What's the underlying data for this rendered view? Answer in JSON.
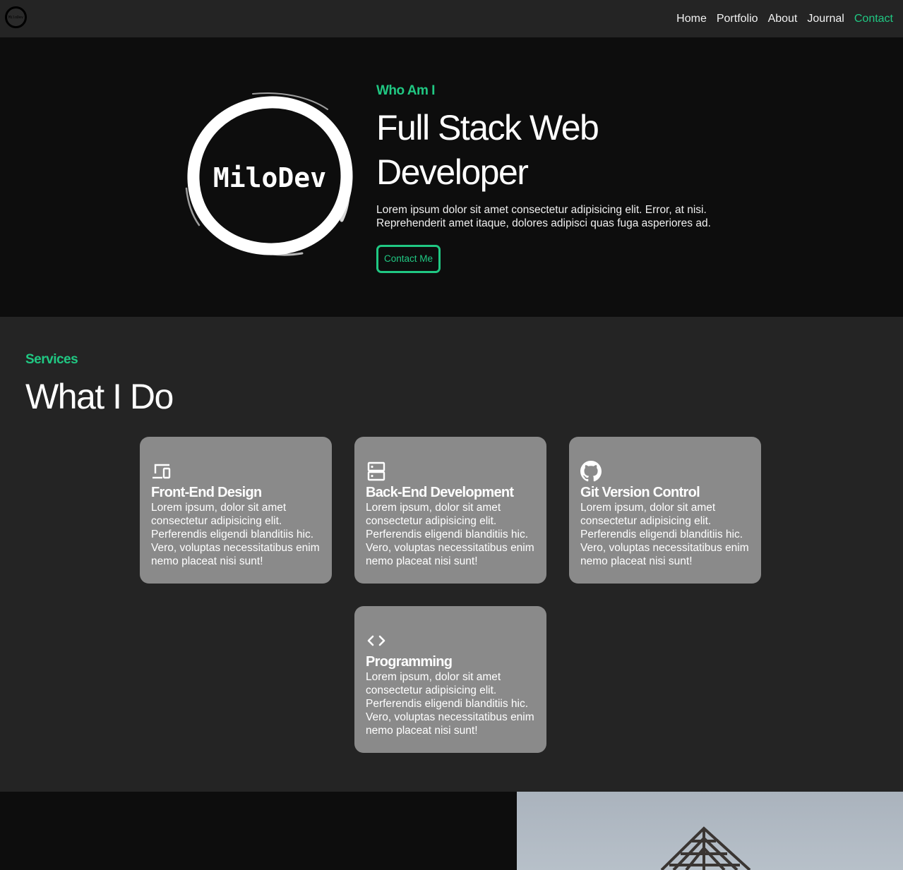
{
  "nav": {
    "logo_text": "MiloDev",
    "links": [
      "Home",
      "Portfolio",
      "About",
      "Journal",
      "Contact"
    ],
    "active": "Contact"
  },
  "hero": {
    "logo_text": "MiloDev",
    "eyebrow": "Who Am I",
    "title": "Full Stack Web Developer",
    "description": "Lorem ipsum dolor sit amet consectetur adipisicing elit. Error, at nisi. Reprehenderit amet itaque, dolores adipisci quas fuga asperiores ad.",
    "button": "Contact Me"
  },
  "services": {
    "eyebrow": "Services",
    "title": "What I Do",
    "cards": [
      {
        "icon": "devices-icon",
        "title": "Front-End Design",
        "desc": "Lorem ipsum, dolor sit amet consectetur adipisicing elit. Perferendis eligendi blanditiis hic. Vero, voluptas necessitatibus enim nemo placeat nisi sunt!"
      },
      {
        "icon": "server-icon",
        "title": "Back-End Development",
        "desc": "Lorem ipsum, dolor sit amet consectetur adipisicing elit. Perferendis eligendi blanditiis hic. Vero, voluptas necessitatibus enim nemo placeat nisi sunt!"
      },
      {
        "icon": "github-icon",
        "title": "Git Version Control",
        "desc": "Lorem ipsum, dolor sit amet consectetur adipisicing elit. Perferendis eligendi blanditiis hic. Vero, voluptas necessitatibus enim nemo placeat nisi sunt!"
      },
      {
        "icon": "code-icon",
        "title": "Programming",
        "desc": "Lorem ipsum, dolor sit amet consectetur adipisicing elit. Perferendis eligendi blanditiis hic. Vero, voluptas necessitatibus enim nemo placeat nisi sunt!"
      }
    ]
  },
  "colors": {
    "accent": "#20c883",
    "nav_bg": "#242424",
    "hero_bg": "#0d0d0d",
    "card_bg": "#8a8a8a"
  }
}
